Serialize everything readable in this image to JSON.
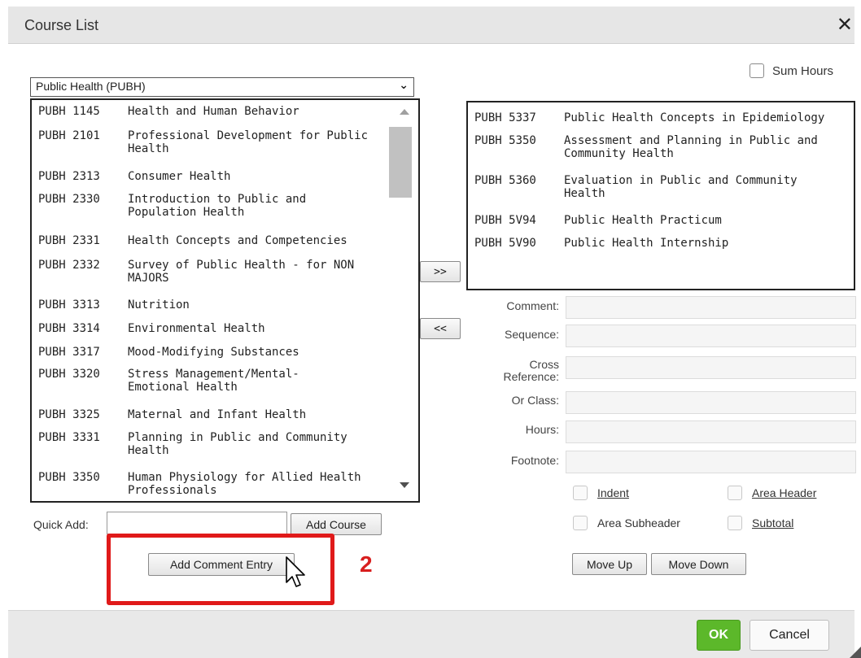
{
  "dialog": {
    "title": "Course List"
  },
  "sum_hours_label": "Sum Hours",
  "subject_select": {
    "selected": "Public Health (PUBH)"
  },
  "available_courses": [
    {
      "code": "PUBH 1145",
      "name": "Health and Human Behavior"
    },
    {
      "code": "PUBH 2101",
      "name": "Professional Development for Public Health"
    },
    {
      "code": "PUBH 2313",
      "name": "Consumer Health"
    },
    {
      "code": "PUBH 2330",
      "name": "Introduction to Public and Population Health"
    },
    {
      "code": "PUBH 2331",
      "name": "Health Concepts and Competencies"
    },
    {
      "code": "PUBH 2332",
      "name": "Survey of Public Health - for NON MAJORS"
    },
    {
      "code": "PUBH 3313",
      "name": "Nutrition"
    },
    {
      "code": "PUBH 3314",
      "name": "Environmental Health"
    },
    {
      "code": "PUBH 3317",
      "name": "Mood-Modifying Substances"
    },
    {
      "code": "PUBH 3320",
      "name": "Stress Management/Mental-Emotional Health"
    },
    {
      "code": "PUBH 3325",
      "name": "Maternal and Infant Health"
    },
    {
      "code": "PUBH 3331",
      "name": "Planning in Public and Community Health"
    },
    {
      "code": "PUBH 3350",
      "name": "Human Physiology for Allied Health Professionals"
    }
  ],
  "selected_courses": [
    {
      "code": "PUBH 5337",
      "name": "Public Health Concepts in Epidemiology"
    },
    {
      "code": "PUBH 5350",
      "name": "Assessment and Planning in Public and Community Health"
    },
    {
      "code": "PUBH 5360",
      "name": "Evaluation in Public and Community Health"
    },
    {
      "code": "PUBH 5V94",
      "name": "Public Health Practicum"
    },
    {
      "code": "PUBH 5V90",
      "name": "Public Health Internship"
    }
  ],
  "move_right_label": ">>",
  "move_left_label": "<<",
  "fields": {
    "comment": "Comment:",
    "sequence": "Sequence:",
    "cross_reference": "Cross Reference:",
    "or_class": "Or Class:",
    "hours": "Hours:",
    "footnote": "Footnote:"
  },
  "options": {
    "indent": "Indent",
    "area_header": "Area Header",
    "area_subheader": "Area Subheader",
    "subtotal": "Subtotal"
  },
  "quick_add": {
    "label": "Quick Add:",
    "value": "",
    "add_course_label": "Add Course"
  },
  "add_comment_entry_label": "Add Comment Entry",
  "move_up_label": "Move Up",
  "move_down_label": "Move Down",
  "annotation": {
    "step": "2",
    "color": "#e01a1a"
  },
  "footer": {
    "ok_label": "OK",
    "cancel_label": "Cancel",
    "ok_color": "#5cb82a"
  },
  "icons": {
    "close": "close-icon",
    "dropdown": "chevron-down-icon",
    "pointer": "cursor-icon"
  }
}
